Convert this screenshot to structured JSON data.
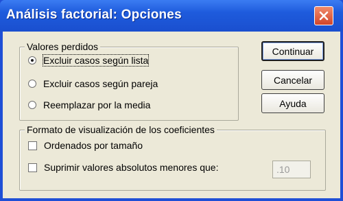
{
  "window": {
    "title": "Análisis factorial: Opciones"
  },
  "missing_values": {
    "group_label": "Valores perdidos",
    "options": [
      {
        "label": "Excluir casos según lista",
        "selected": true
      },
      {
        "label": "Excluir casos según pareja",
        "selected": false
      },
      {
        "label": "Reemplazar por la media",
        "selected": false
      }
    ]
  },
  "coefficient_format": {
    "group_label": "Formato de visualización de los coeficientes",
    "sort_by_size_label": "Ordenados por tamaño",
    "sort_by_size_checked": false,
    "suppress_label": "Suprimir valores absolutos menores que:",
    "suppress_checked": false,
    "suppress_value": ".10"
  },
  "buttons": {
    "continue_label": "Continuar",
    "cancel_label": "Cancelar",
    "help_label": "Ayuda"
  },
  "colors": {
    "titlebar": "#1f4fd6",
    "dialog_face": "#ece9d8",
    "close_button": "#d2452a"
  }
}
